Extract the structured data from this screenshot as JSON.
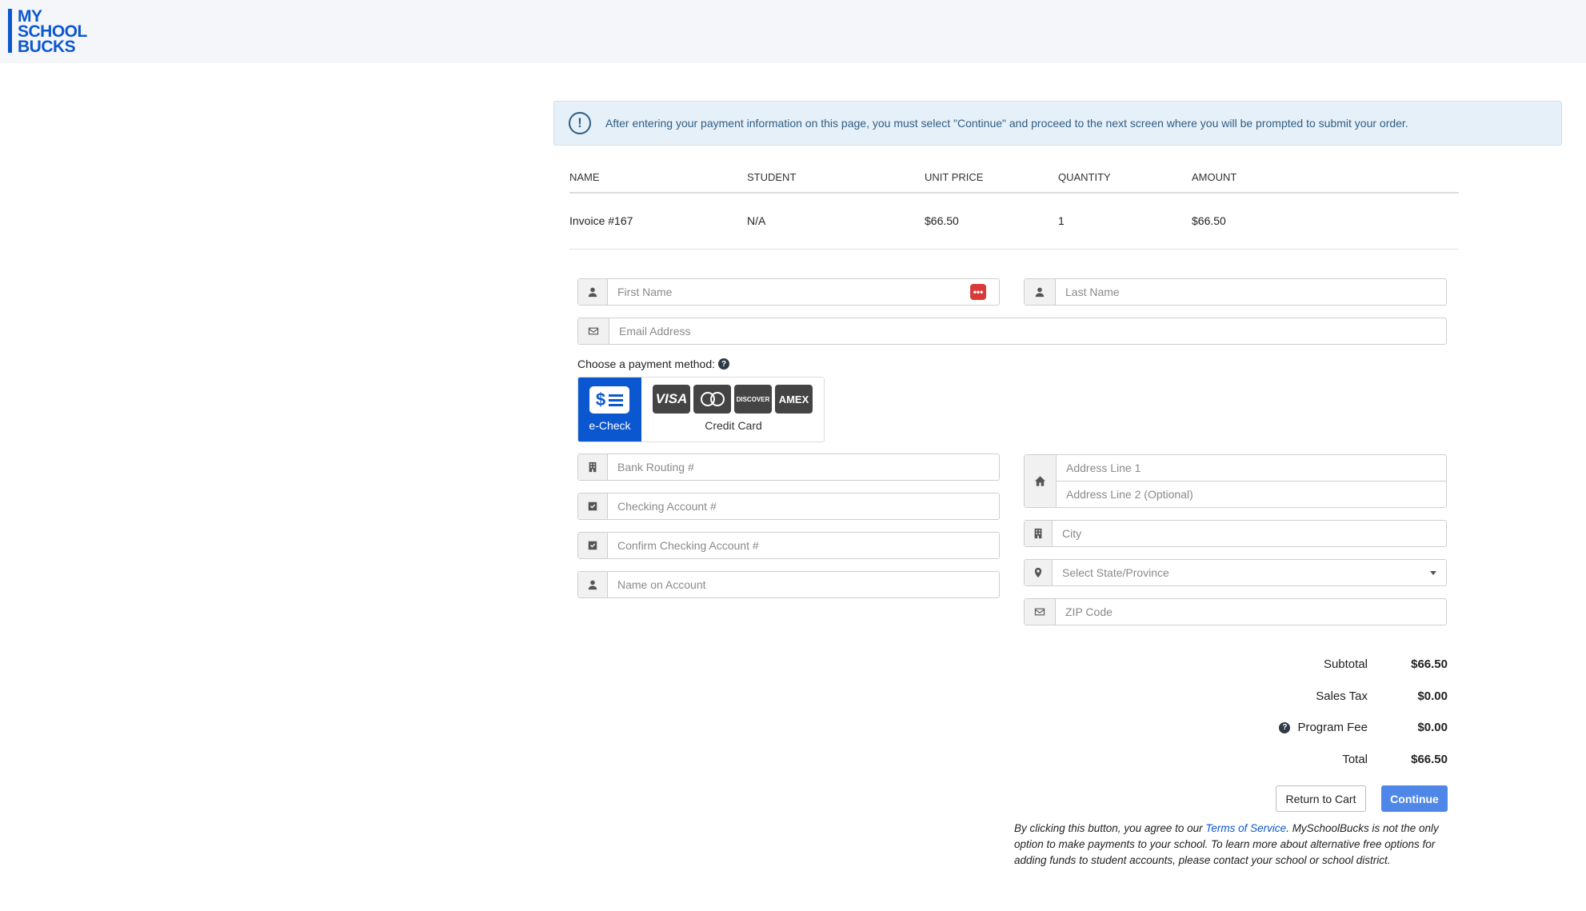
{
  "logo": {
    "line1": "MY",
    "line2": "SCHOOL",
    "line3": "BUCKS"
  },
  "notice": {
    "text": "After entering your payment information on this page, you must select \"Continue\" and proceed to the next screen where you will be prompted to submit your order."
  },
  "table": {
    "headers": [
      "NAME",
      "STUDENT",
      "UNIT PRICE",
      "QUANTITY",
      "AMOUNT"
    ],
    "rows": [
      [
        "Invoice #167",
        "N/A",
        "$66.50",
        "1",
        "$66.50"
      ]
    ]
  },
  "form": {
    "first_name": "First Name",
    "last_name": "Last Name",
    "email": "Email Address",
    "payment_method_label": "Choose a payment method:",
    "echeck_label": "e-Check",
    "credit_card_label": "Credit Card",
    "cards": [
      "VISA",
      "MC",
      "DISCOVER",
      "AMEX"
    ],
    "bank_routing": "Bank Routing #",
    "checking_account": "Checking Account #",
    "confirm_checking": "Confirm Checking Account #",
    "name_on_account": "Name on Account",
    "address1": "Address Line 1",
    "address2": "Address Line 2 (Optional)",
    "city": "City",
    "state": "Select State/Province",
    "zip": "ZIP Code"
  },
  "totals": {
    "subtotal_label": "Subtotal",
    "subtotal": "$66.50",
    "tax_label": "Sales Tax",
    "tax": "$0.00",
    "fee_label": "Program Fee",
    "fee": "$0.00",
    "total_label": "Total",
    "total": "$66.50"
  },
  "buttons": {
    "return": "Return to Cart",
    "continue": "Continue"
  },
  "disclaimer": {
    "before": "By clicking this button, you agree to our ",
    "link": "Terms of Service",
    "after": ".  MySchoolBucks is not the only option to make payments to your school. To learn more about alternative free options for adding funds to student accounts, please contact your school or school district."
  },
  "colors": {
    "brand": "#0b57d0",
    "continue": "#4f87e8",
    "notice_bg": "#e6f0f9"
  }
}
